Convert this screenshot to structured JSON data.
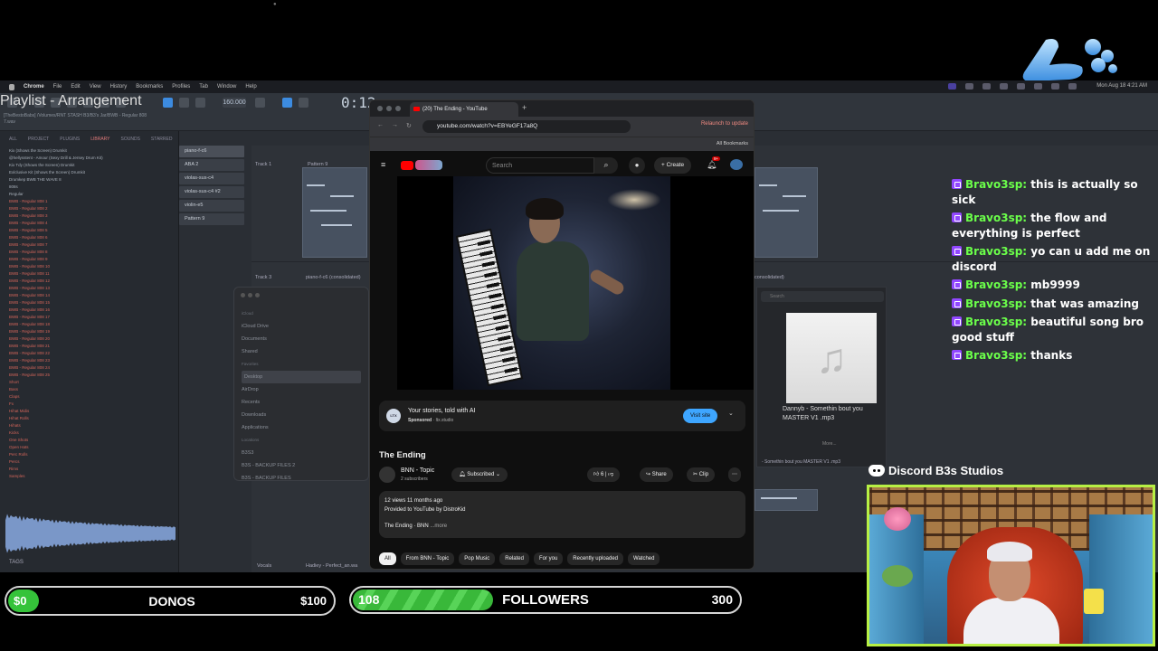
{
  "menubar": {
    "app": "Chrome",
    "items": [
      "File",
      "Edit",
      "View",
      "History",
      "Bookmarks",
      "Profiles",
      "Tab",
      "Window",
      "Help"
    ],
    "clock": "Mon Aug 18 4:21 AM"
  },
  "daw": {
    "bpm": "160.000",
    "time": "0:12",
    "hint": "[TheBestoBabs] /Volumes/RNT STASH B3/B3's Jar/BWB - Regular 808 7.wav",
    "playlist_title": "Playlist - Arrangement",
    "browser_tabs": [
      "ALL",
      "PROJECT",
      "PLUGINS",
      "LIBRARY",
      "SOUNDS",
      "STARRED"
    ],
    "browser_items": [
      "Kix (Shows the Screen) Drumkit",
      "@hellysstent - Amour (Sexy Drill & Jersey Drum Kit)",
      "Kix Tdy (Shows the Screen) Drumkit",
      "Exlclusive Kit (Shows the Screen) Drumkit",
      "Drumkep BWB THE WAVE 8",
      "808s",
      "Regular",
      "BWB - Regular 808 1",
      "BWB - Regular 808 2",
      "BWB - Regular 808 3",
      "BWB - Regular 808 4",
      "BWB - Regular 808 5",
      "BWB - Regular 808 6",
      "BWB - Regular 808 7",
      "BWB - Regular 808 8",
      "BWB - Regular 808 9",
      "BWB - Regular 808 10",
      "BWB - Regular 808 11",
      "BWB - Regular 808 12",
      "BWB - Regular 808 13",
      "BWB - Regular 808 14",
      "BWB - Regular 808 15",
      "BWB - Regular 808 16",
      "BWB - Regular 808 17",
      "BWB - Regular 808 18",
      "BWB - Regular 808 19",
      "BWB - Regular 808 20",
      "BWB - Regular 808 21",
      "BWB - Regular 808 22",
      "BWB - Regular 808 23",
      "BWB - Regular 808 24",
      "BWB - Regular 808 25",
      "Short",
      "Bass",
      "Claps",
      "Fx",
      "Hihat Midis",
      "Hihat Rolls",
      "Hihats",
      "Kicks",
      "One Shots",
      "Open Hats",
      "Perc Rolls",
      "Percs",
      "Rims",
      "Samples"
    ],
    "tags_label": "TAGS",
    "channels": [
      "piano-f-c6",
      "ABA 2",
      "violas-sus-c4",
      "violas-sus-c4 #2",
      "violin-e5",
      "Pattern 9"
    ],
    "tracks": {
      "track1": "Track 1",
      "track3": "Track 3",
      "pattern": "Pattern 9",
      "clip_a": "piano-f-c6 (consolidated)",
      "clip_b": "consolidated)",
      "vocals": "Vocals",
      "vocal_clip": "Hadiey - Perfect_an.wa"
    },
    "finder": {
      "sections": [
        {
          "heading": "iCloud",
          "items": [
            "iCloud Drive",
            "Documents",
            "Shared"
          ]
        },
        {
          "heading": "Favorites",
          "items": [
            "Desktop",
            "AirDrop",
            "Recents",
            "Downloads",
            "Applications"
          ]
        },
        {
          "heading": "Locations",
          "items": [
            "B3S3",
            "B3S - BACKUP FILES 2",
            "B3S - BACKUP FILES"
          ]
        }
      ],
      "selected": "Desktop"
    },
    "music_card": {
      "search": "Search",
      "title": "Dannyb - Somethin bout you MASTER V1 .mp3",
      "more": "More...",
      "footer": "- Somethin bout you MASTER V1 .mp3"
    }
  },
  "chrome": {
    "tab_title": "(20) The Ending - YouTube",
    "url": "youtube.com/watch?v=EBYeGF17a8Q",
    "relaunch": "Relaunch to update",
    "bookmarks": "All Bookmarks"
  },
  "youtube": {
    "search_placeholder": "Search",
    "create_label": "Create",
    "notif_count": "9+",
    "ad": {
      "title": "Your stories, told with AI",
      "sponsored": "Sponsored",
      "domain": "· ltx.studio",
      "logo_text": "LTX",
      "cta": "Visit site"
    },
    "video_title": "The Ending",
    "channel": "BNN - Topic",
    "subscribers": "2 subscribers",
    "subscribe_label": "Subscribed",
    "likes": "6",
    "share": "Share",
    "clip": "Clip",
    "description": {
      "meta": "12 views  11 months ago",
      "provided": "Provided to YouTube by DistroKid",
      "line": "The Ending · BNN",
      "more": "...more"
    },
    "chips": [
      "All",
      "From BNN - Topic",
      "Pop Music",
      "Related",
      "For you",
      "Recently uploaded",
      "Watched"
    ]
  },
  "chat": [
    {
      "user": "Bravo3sp:",
      "text": "this is actually so sick"
    },
    {
      "user": "Bravo3sp:",
      "text": "the flow and everything is perfect"
    },
    {
      "user": "Bravo3sp:",
      "text": "yo can u add me on discord"
    },
    {
      "user": "Bravo3sp:",
      "text": "mb9999"
    },
    {
      "user": "Bravo3sp:",
      "text": "that was amazing"
    },
    {
      "user": "Bravo3sp:",
      "text": "beautiful song bro good stuff"
    },
    {
      "user": "Bravo3sp:",
      "text": "thanks"
    }
  ],
  "discord": {
    "label": "Discord B3s Studios"
  },
  "goals": {
    "donos": {
      "label": "DONOS",
      "current": "$0",
      "max": "$100",
      "progress": 0.0
    },
    "followers": {
      "label": "FOLLOWERS",
      "current": "108",
      "max": "300",
      "progress": 0.36
    }
  },
  "colors": {
    "chat_user": "#6bff4a",
    "webcam_border": "#b7f044",
    "goal_fill": "#35c33a",
    "yt_accent": "#3ea6ff"
  }
}
